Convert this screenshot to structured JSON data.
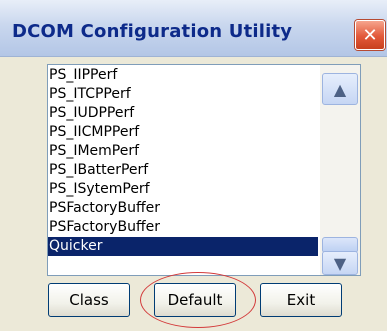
{
  "window": {
    "title": "DCOM Configuration Utility",
    "close_glyph": "✕"
  },
  "list": {
    "items": [
      "PS_IIPPerf",
      "PS_ITCPPerf",
      "PS_IUDPPerf",
      "PS_IICMPPerf",
      "PS_IMemPerf",
      "PS_IBatterPerf",
      "PS_ISytemPerf",
      "PSFactoryBuffer",
      "PSFactoryBuffer",
      "Quicker"
    ],
    "selected_item": "Quicker"
  },
  "scrollbar": {
    "up_glyph": "▲",
    "down_glyph": "▼"
  },
  "buttons": {
    "class_label": "Class",
    "default_label": "Default",
    "exit_label": "Exit"
  },
  "colors": {
    "title_text": "#0d2a8a",
    "selection": "#0a246a",
    "annotation_circle": "#d33b3b"
  }
}
